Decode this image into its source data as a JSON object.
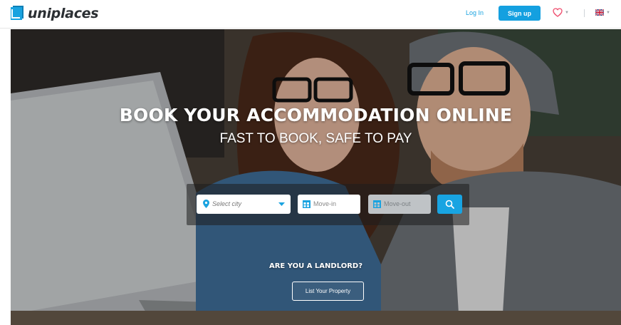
{
  "header": {
    "logo_text": "uniplaces",
    "login_label": "Log In",
    "signup_label": "Sign up",
    "favorites_icon": "heart-icon",
    "language_icon": "uk-flag-icon",
    "accent_color": "#14a0e0"
  },
  "hero": {
    "title": "BOOK YOUR ACCOMMODATION ONLINE",
    "subtitle": "FAST TO BOOK, SAFE TO PAY",
    "search": {
      "city_placeholder": "Select city",
      "move_in_placeholder": "Move-in",
      "move_out_placeholder": "Move-out"
    },
    "landlord_heading": "ARE YOU A LANDLORD?",
    "list_property_label": "List Your Property"
  }
}
